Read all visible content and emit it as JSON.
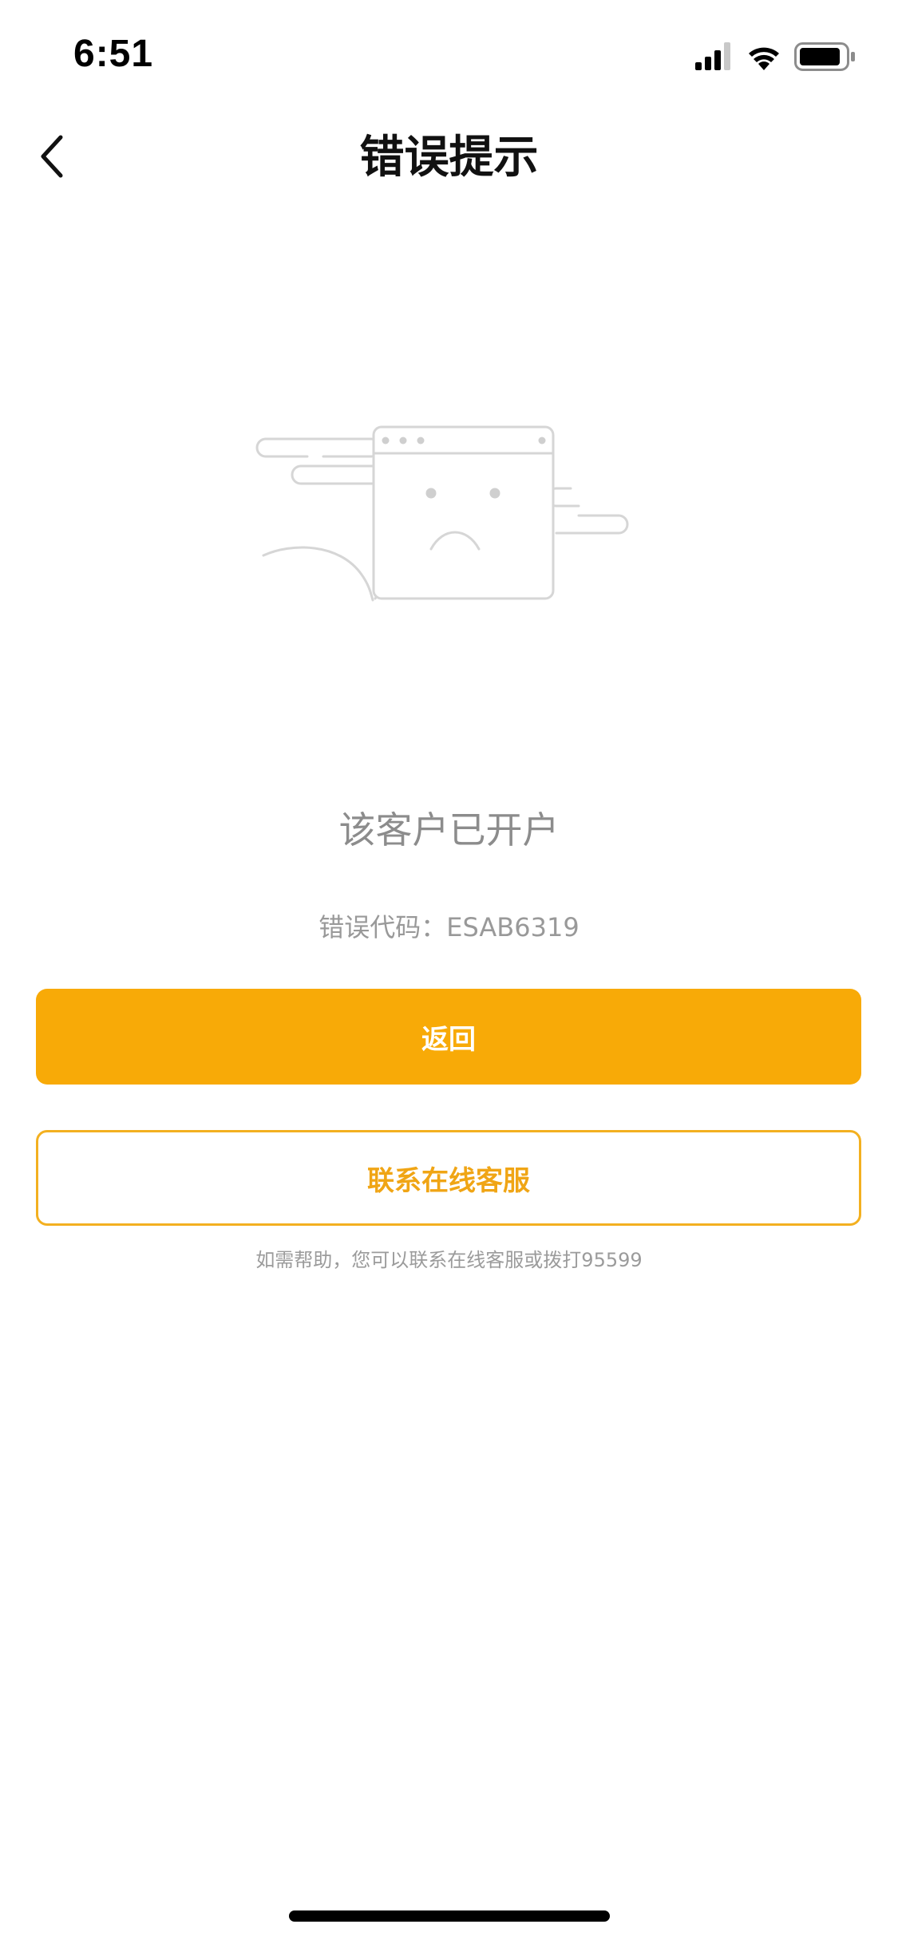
{
  "status_bar": {
    "time": "6:51",
    "icons": [
      "signal-icon",
      "wifi-icon",
      "battery-icon"
    ]
  },
  "nav": {
    "back_icon": "chevron-left-icon",
    "title": "错误提示"
  },
  "illustration": {
    "icon": "error-browser-window-sad-face-icon"
  },
  "error": {
    "message": "该客户已开户",
    "code_text": "错误代码：ESAB6319"
  },
  "buttons": {
    "return_label": "返回",
    "contact_label": "联系在线客服"
  },
  "help": {
    "text": "如需帮助，您可以联系在线客服或拨打95599"
  },
  "colors": {
    "accent": "#f8aa07",
    "outline": "#f3b020",
    "muted_text": "#999999"
  }
}
